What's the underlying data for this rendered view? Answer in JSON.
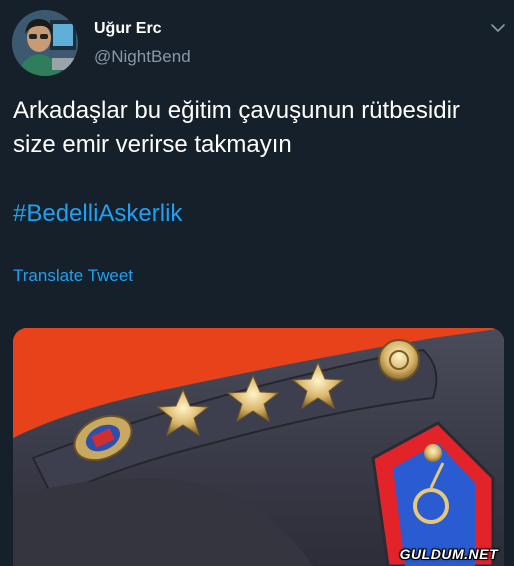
{
  "user": {
    "display_name": "Uğur Erc",
    "handle": "@NightBend"
  },
  "tweet": {
    "text": "Arkadaşlar bu eğitim çavuşunun rütbesidir size emir verirse takmayın",
    "hashtag": "#BedelliAskerlik",
    "translate_label": "Translate Tweet"
  },
  "media": {
    "watermark": "GULDUM.NET"
  },
  "icons": {
    "menu": "chevron-down-icon"
  },
  "colors": {
    "background": "#15202b",
    "link": "#1da1f2",
    "secondary_text": "#8899a6",
    "photo_background": "#e8421a",
    "uniform": "#3a3b49"
  }
}
